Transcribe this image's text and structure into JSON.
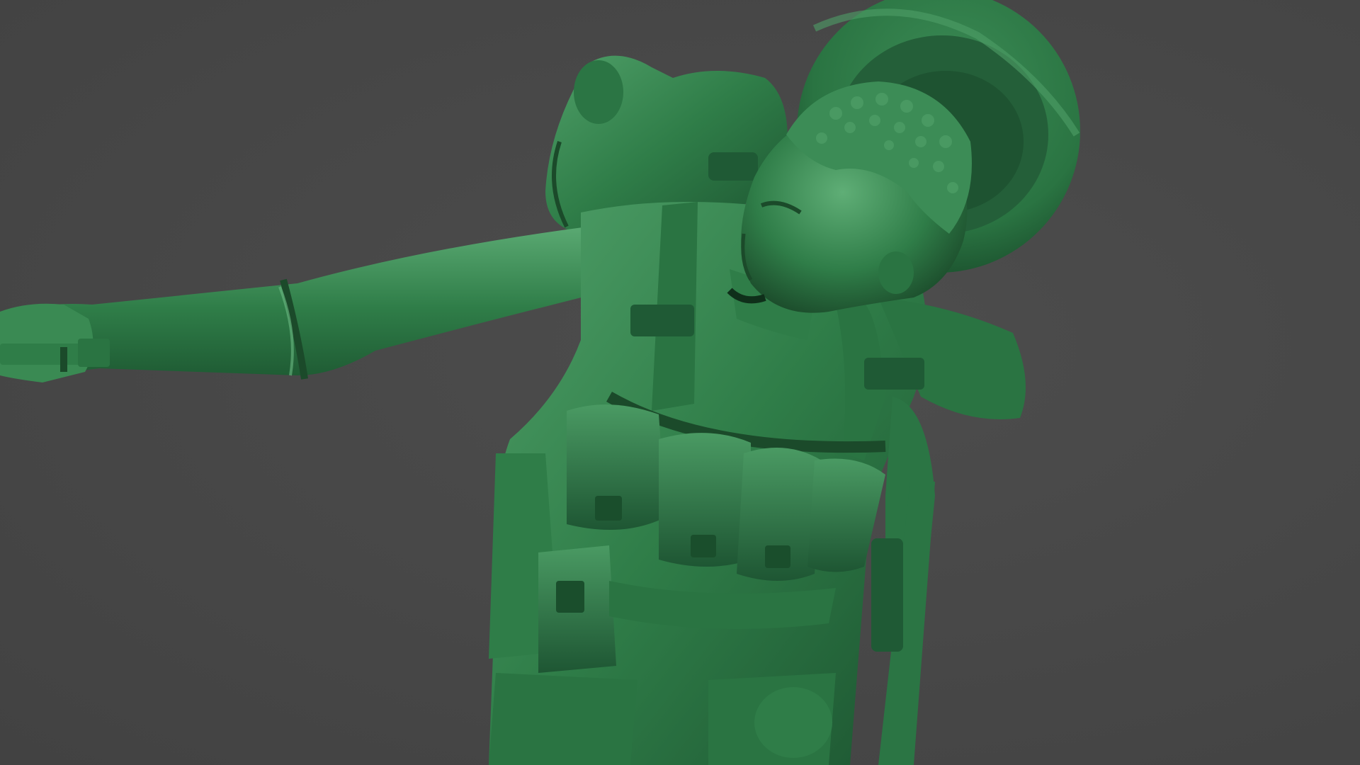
{
  "scene": {
    "subject": "green-soldier-figure-sculpt",
    "background_color": "#474747",
    "figure_colors": {
      "base": "#2f7d48",
      "highlight": "#5fae76",
      "shadow": "#1b4a2a",
      "deep_shadow": "#0f2f1a"
    }
  }
}
